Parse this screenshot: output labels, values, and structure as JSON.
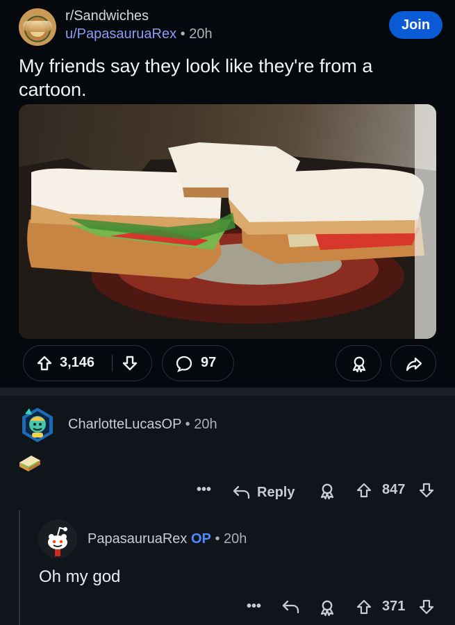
{
  "post": {
    "subreddit": "r/Sandwiches",
    "author": "u/PapasauruaRex",
    "separator": "•",
    "age": "20h",
    "join_label": "Join",
    "title": "My friends say they look like they're from a cartoon.",
    "votes": "3,146",
    "comments": "97",
    "icons": [
      "subreddit-avatar",
      "upvote-icon",
      "downvote-icon",
      "comment-icon",
      "award-icon",
      "share-icon"
    ]
  },
  "comments": [
    {
      "author": "CharlotteLucasOP",
      "separator": "•",
      "age": "20h",
      "body_icon": "sandwich-emoji",
      "more": "•••",
      "reply_label": "Reply",
      "score": "847"
    },
    {
      "author": "PapasauruaRex",
      "op_badge": "OP",
      "separator": "•",
      "age": "20h",
      "body": "Oh my god",
      "more": "•••",
      "score": "371"
    }
  ],
  "colors": {
    "background": "#05080c",
    "accent": "#0b5bd6",
    "username_link": "#8b9cf5",
    "op_badge": "#4b8cff"
  }
}
